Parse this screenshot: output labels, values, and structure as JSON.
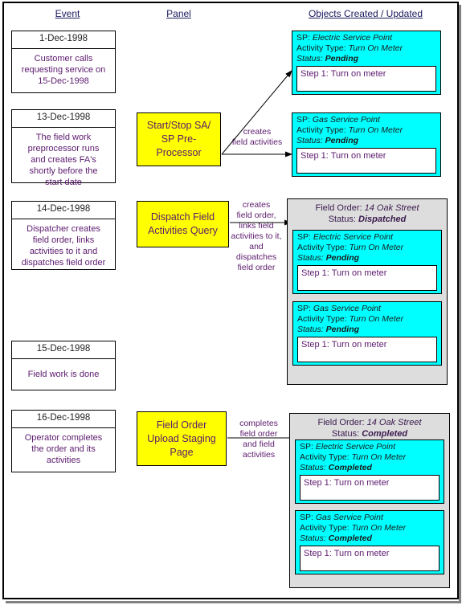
{
  "headers": {
    "event": "Event",
    "panel": "Panel",
    "objects": "Objects Created / Updated"
  },
  "colors": {
    "activity_fill": "#00FFFF",
    "panel_fill": "#FFFF00",
    "group_fill": "#DDDDDD",
    "text_purple": "#5C1A6E",
    "header_text": "#1A1A5E",
    "border": "#000000"
  },
  "events": [
    {
      "date": "1-Dec-1998",
      "desc": "Customer calls\nrequesting service on\n15-Dec-1998"
    },
    {
      "date": "13-Dec-1998",
      "desc": "The field work\npreprocessor runs\nand creates FA's\nshortly before the\nstart date"
    },
    {
      "date": "14-Dec-1998",
      "desc": "Dispatcher creates\nfield order, links\nactivities to it and\ndispatches field order"
    },
    {
      "date": "15-Dec-1998",
      "desc": "Field work is done"
    },
    {
      "date": "16-Dec-1998",
      "desc": "Operator completes\nthe order and its\nactivities"
    }
  ],
  "panels": [
    {
      "label": "Start/Stop SA/\nSP Pre-\nProcessor"
    },
    {
      "label": "Dispatch Field\nActivities Query"
    },
    {
      "label": "Field Order\nUpload Staging\nPage"
    }
  ],
  "arrow_labels": [
    {
      "text": "creates\nfield activities"
    },
    {
      "text": "creates\nfield order,\nlinks field\nactivities to it,\nand\ndispatches\nfield order"
    },
    {
      "text": "completes\nfield order\nand field\nactivities"
    }
  ],
  "activity_labels": {
    "sp": "SP:",
    "activity_type": "Activity Type:",
    "status": "Status:",
    "field_order": "Field Order:",
    "fo_status": "Status:"
  },
  "stage1": {
    "activities": [
      {
        "sp": "Electric Service Point",
        "activity_type": "Turn On Meter",
        "status": "Pending",
        "step": "Step 1: Turn on meter"
      },
      {
        "sp": "Gas Service Point",
        "activity_type": "Turn On Meter",
        "status": "Pending",
        "step": "Step 1: Turn on meter"
      }
    ]
  },
  "stage2": {
    "field_order": "14 Oak Street",
    "fo_status": "Dispatched",
    "activities": [
      {
        "sp": "Electric Service Point",
        "activity_type": "Turn On Meter",
        "status": "Pending",
        "step": "Step 1: Turn on meter"
      },
      {
        "sp": "Gas Service Point",
        "activity_type": "Turn On Meter",
        "status": "Pending",
        "step": "Step 1: Turn on meter"
      }
    ]
  },
  "stage3": {
    "field_order": "14 Oak Street",
    "fo_status": "Completed",
    "activities": [
      {
        "sp": "Electric Service Point",
        "activity_type": "Turn On Meter",
        "status": "Completed",
        "step": "Step 1: Turn on meter"
      },
      {
        "sp": "Gas Service Point",
        "activity_type": "Turn On Meter",
        "status": "Completed",
        "step": "Step 1: Turn on meter"
      }
    ]
  }
}
